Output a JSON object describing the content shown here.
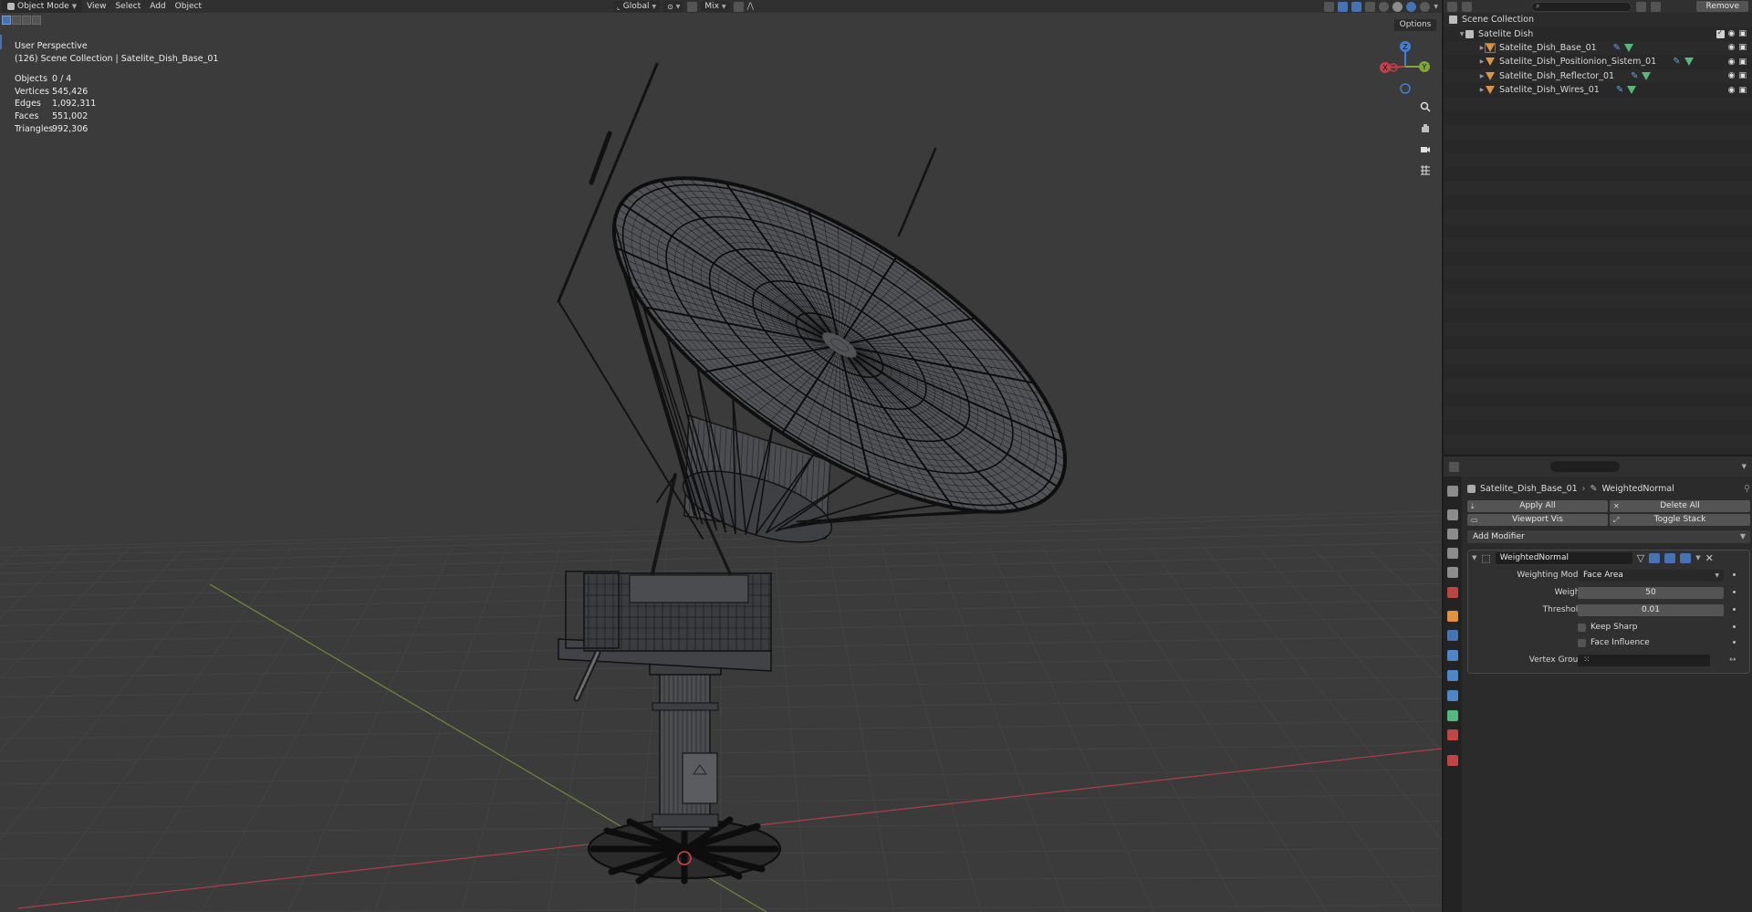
{
  "viewport_header": {
    "mode": "Object Mode",
    "menus": [
      "View",
      "Select",
      "Add",
      "Object"
    ],
    "orientation": "Global",
    "snap": "Mix",
    "options": "Options"
  },
  "overlay": {
    "view_name": "User Perspective",
    "collection_line": "(126) Scene Collection | Satelite_Dish_Base_01"
  },
  "stats": [
    {
      "label": "Objects",
      "value": "0 / 4"
    },
    {
      "label": "Vertices",
      "value": "545,426"
    },
    {
      "label": "Edges",
      "value": "1,092,311"
    },
    {
      "label": "Faces",
      "value": "551,002"
    },
    {
      "label": "Triangles",
      "value": "992,306"
    }
  ],
  "gizmo": {
    "x": "X",
    "y": "Y",
    "z": "Z"
  },
  "outliner": {
    "remove_label": "Remove",
    "scene_collection": "Scene Collection",
    "collection": "Satelite Dish",
    "objects": [
      "Satelite_Dish_Base_01",
      "Satelite_Dish_Positionion_Sistem_01",
      "Satelite_Dish_Reflector_01",
      "Satelite_Dish_Wires_01"
    ]
  },
  "properties": {
    "object_name": "Satelite_Dish_Base_01",
    "modifier_crumb": "WeightedNormal",
    "apply_all": "Apply All",
    "delete_all": "Delete All",
    "viewport_vis": "Viewport Vis",
    "toggle_stack": "Toggle Stack",
    "add_modifier": "Add Modifier",
    "modifier": {
      "name": "WeightedNormal",
      "weighting_mode_label": "Weighting Mode",
      "weighting_mode_value": "Face Area",
      "weight_label": "Weight",
      "weight_value": "50",
      "threshold_label": "Threshold",
      "threshold_value": "0.01",
      "keep_sharp": "Keep Sharp",
      "face_influence": "Face Influence",
      "vertex_group_label": "Vertex Group"
    }
  },
  "colors": {
    "accent": "#4772b3",
    "mesh_icon": "#e1923e",
    "modifier_wrench": "#5ea7e6",
    "data_icon": "#56b87a",
    "x_axis": "#c2404b",
    "y_axis": "#7fa83a",
    "z_axis": "#3f81d8"
  }
}
